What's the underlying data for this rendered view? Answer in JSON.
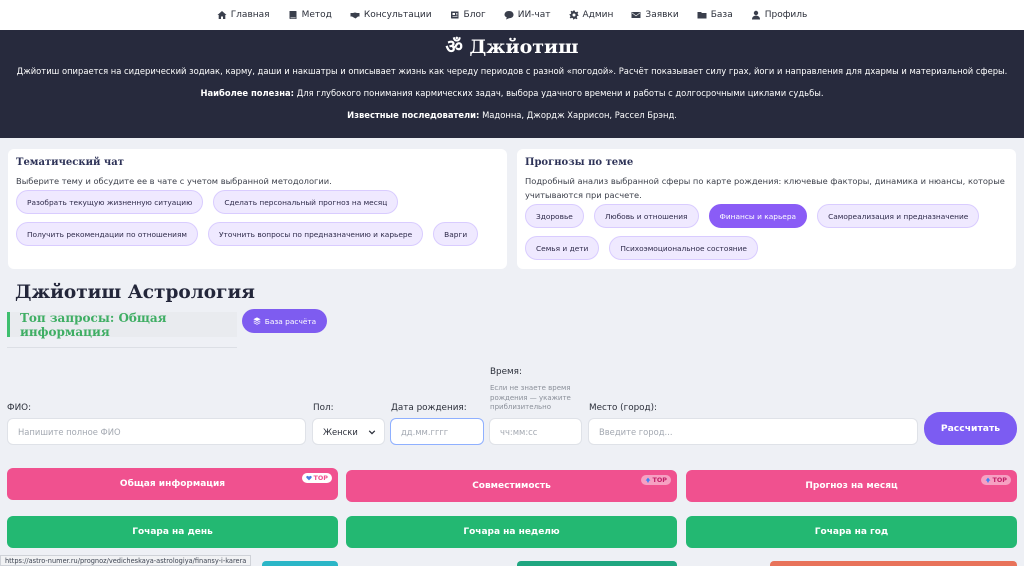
{
  "nav": {
    "items": [
      {
        "label": "Главная",
        "icon": "home-icon"
      },
      {
        "label": "Метод",
        "icon": "book-icon"
      },
      {
        "label": "Консультации",
        "icon": "handshake-icon"
      },
      {
        "label": "Блог",
        "icon": "newspaper-icon"
      },
      {
        "label": "ИИ-чат",
        "icon": "chat-icon"
      },
      {
        "label": "Админ",
        "icon": "gear-icon"
      },
      {
        "label": "Заявки",
        "icon": "envelope-icon"
      },
      {
        "label": "База",
        "icon": "folder-icon"
      },
      {
        "label": "Профиль",
        "icon": "user-icon"
      }
    ]
  },
  "hero": {
    "title": "ॐ Джйотиш",
    "description": "Джйотиш опирается на сидерический зодиак, карму, даши и накшатры и описывает жизнь как череду периодов с разной «погодой». Расчёт показывает силу грах, йоги и направления для дхармы и материальной сферы.",
    "useful_label": "Наиболее полезна:",
    "useful_text": " Для глубокого понимания кармических задач, выбора удачного времени и работы с долгосрочными циклами судьбы.",
    "followers_label": "Известные последователи:",
    "followers_text": " Мадонна, Джордж Харрисон, Рассел Брэнд."
  },
  "chat_card": {
    "title": "Тематический чат",
    "text": "Выберите тему и обсудите ее в чате с учетом выбранной методологии.",
    "chips": [
      "Разобрать текущую жизненную ситуацию",
      "Сделать персональный прогноз на месяц",
      "Получить рекомендации по отношениям",
      "Уточнить вопросы по предназначению и карьере",
      "Варги"
    ]
  },
  "forecast_card": {
    "title": "Прогнозы по теме",
    "text": "Подробный анализ выбранной сферы по карте рождения: ключевые факторы, динамика и нюансы, которые учитываются при расчете.",
    "chips": [
      "Здоровье",
      "Любовь и отношения",
      "Финансы и карьера",
      "Самореализация и предназначение",
      "Семья и дети",
      "Психоэмоциональное состояние"
    ],
    "active_chip": "Финансы и карьера"
  },
  "main": {
    "title": "Джйотиш Астрология",
    "top_requests": "Топ запросы: Общая информация",
    "base_button": "База расчёта"
  },
  "form": {
    "fio_label": "ФИО:",
    "fio_placeholder": "Напишите полное ФИО",
    "gender_label": "Пол:",
    "gender_value": "Женски",
    "birthdate_label": "Дата рождения:",
    "birthdate_placeholder": "дд.мм.гггг",
    "time_label": "Время:",
    "time_hint": "Если не знаете время рождения — укажите приблизительно",
    "time_placeholder": "чч:мм:сс",
    "place_label": "Место (город):",
    "place_placeholder": "Введите город...",
    "submit": "Рассчитать"
  },
  "actions": {
    "row1": [
      {
        "label": "Общая информация",
        "badge": "TOP"
      },
      {
        "label": "Совместимость",
        "badge": "TOP"
      },
      {
        "label": "Прогноз на месяц",
        "badge": "TOP"
      }
    ],
    "row2": [
      {
        "label": "Гочара на день"
      },
      {
        "label": "Гочара на неделю"
      },
      {
        "label": "Гочара на год"
      }
    ]
  },
  "status_url": "https://astro-numer.ru/prognoz/vedicheskaya-astrologiya/finansy-i-karera",
  "colors": {
    "accent": "#7e5cf0",
    "pink": "#f0518f",
    "green": "#23b872",
    "hero_bg": "#272a3d"
  }
}
